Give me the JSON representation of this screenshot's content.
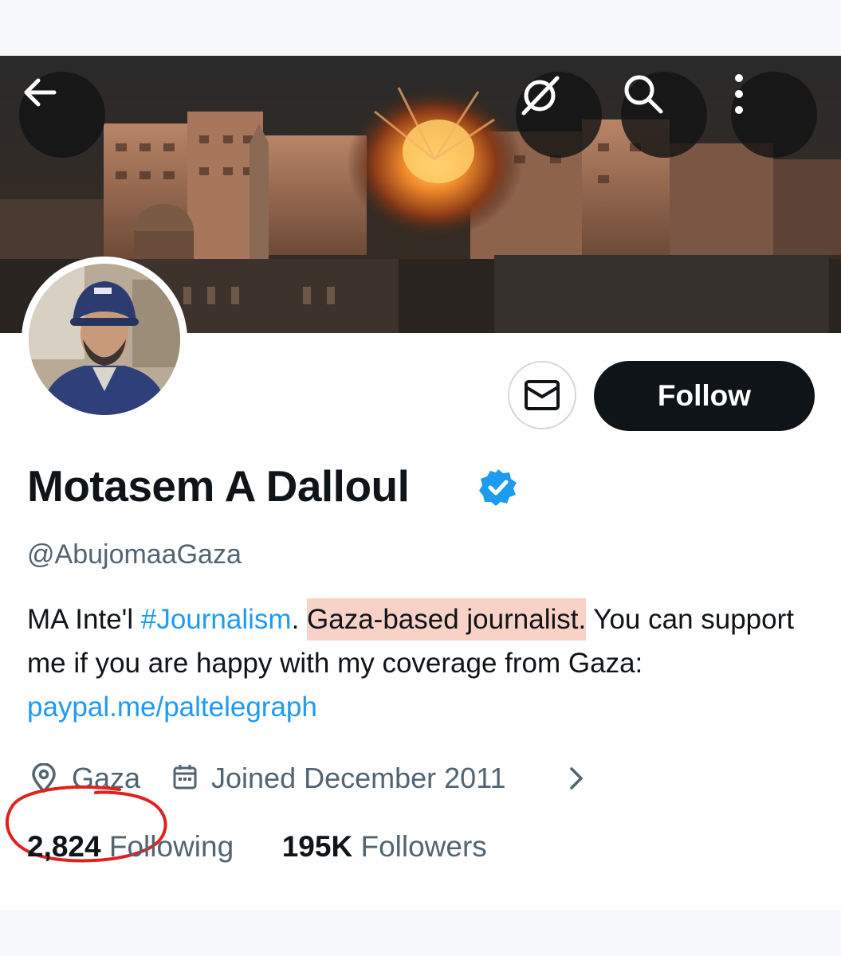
{
  "profile": {
    "display_name": "Motasem A Dalloul",
    "handle": "@AbujomaaGaza",
    "verified": true,
    "location": "Gaza",
    "joined": "Joined December 2011",
    "following_count": "2,824",
    "following_label": "Following",
    "followers_count": "195K",
    "followers_label": "Followers"
  },
  "bio": {
    "part1": "MA Inte'l ",
    "hashtag": "#Journalism",
    "part2": ". ",
    "highlight": "Gaza-based journalist.",
    "part3": " You can support me if you are happy with my coverage from Gaza: ",
    "link": "paypal.me/paltelegraph"
  },
  "actions": {
    "follow_label": "Follow"
  },
  "icons": {
    "back": "arrow-left-icon",
    "grok": "grok-icon",
    "search": "search-icon",
    "more": "more-vertical-icon",
    "message": "envelope-icon",
    "location": "location-pin-icon",
    "calendar": "calendar-icon",
    "chevron": "chevron-right-icon",
    "verified": "verified-badge-icon"
  },
  "colors": {
    "accent": "#1d9bf0",
    "text": "#0f1419",
    "secondary": "#536471",
    "follow_bg": "#0f1419",
    "highlight": "#f8d2c7",
    "annotation": "#e0221f"
  }
}
